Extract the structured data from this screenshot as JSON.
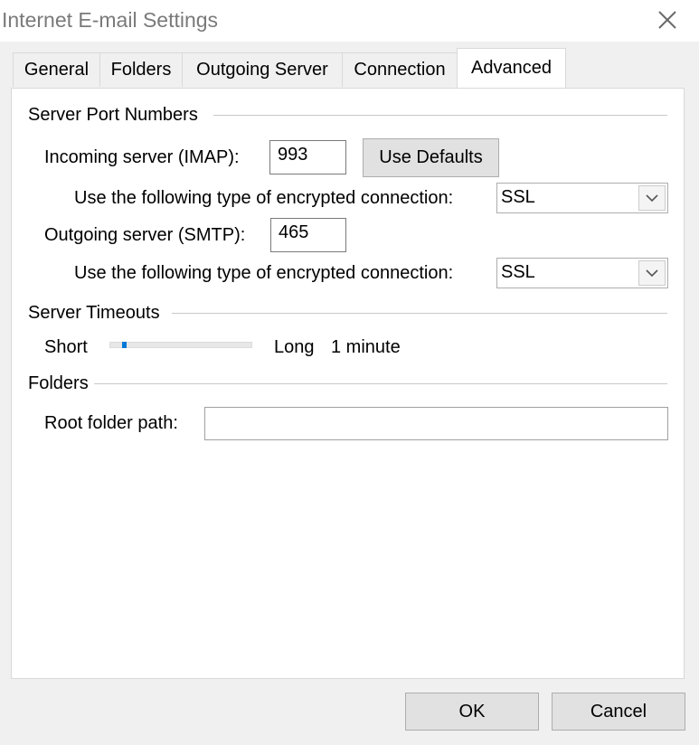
{
  "window": {
    "title": "Internet E-mail Settings",
    "close_icon": "close-icon"
  },
  "tabs": [
    {
      "label": "General",
      "active": false
    },
    {
      "label": "Folders",
      "active": false
    },
    {
      "label": "Outgoing Server",
      "active": false
    },
    {
      "label": "Connection",
      "active": false
    },
    {
      "label": "Advanced",
      "active": true
    }
  ],
  "server_ports": {
    "section_title": "Server Port Numbers",
    "incoming_label": "Incoming server (IMAP):",
    "incoming_value": "993",
    "use_defaults_label": "Use Defaults",
    "incoming_encryption_label": "Use the following type of encrypted connection:",
    "incoming_encryption_value": "SSL",
    "outgoing_label": "Outgoing server (SMTP):",
    "outgoing_value": "465",
    "outgoing_encryption_label": "Use the following type of encrypted connection:",
    "outgoing_encryption_value": "SSL"
  },
  "timeouts": {
    "section_title": "Server Timeouts",
    "short_label": "Short",
    "long_label": "Long",
    "value_text": "1 minute",
    "slider_level": 0.09
  },
  "folders": {
    "section_title": "Folders",
    "root_label": "Root folder path:",
    "root_value": ""
  },
  "buttons": {
    "ok": "OK",
    "cancel": "Cancel"
  },
  "colors": {
    "accent": "#0078d7",
    "panel": "#ffffff",
    "background": "#f0f0f0"
  }
}
